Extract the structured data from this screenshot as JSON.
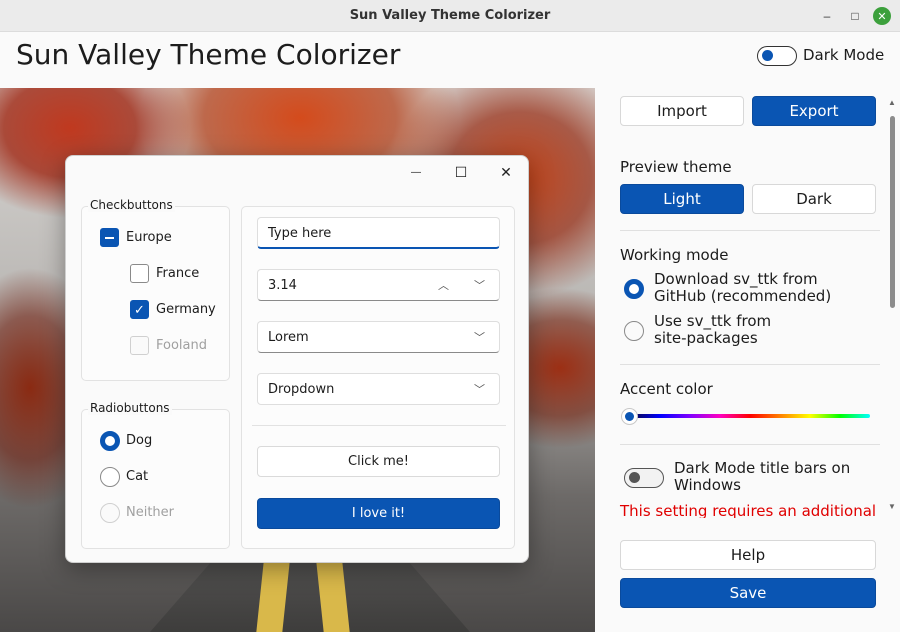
{
  "window": {
    "title": "Sun Valley Theme Colorizer",
    "controls": {
      "minimize": "–",
      "maximize": "□",
      "close": "✕"
    }
  },
  "header": {
    "app_title": "Sun Valley Theme Colorizer",
    "dark_mode_label": "Dark Mode",
    "dark_mode_on": false
  },
  "demo": {
    "controls": {
      "minimize": "—",
      "maximize": "☐",
      "close": "✕"
    },
    "checkbuttons": {
      "group_label": "Checkbuttons",
      "items": [
        {
          "label": "Europe",
          "state": "indeterminate"
        },
        {
          "label": "France",
          "state": "unchecked"
        },
        {
          "label": "Germany",
          "state": "checked"
        },
        {
          "label": "Fooland",
          "state": "disabled"
        }
      ]
    },
    "radiobuttons": {
      "group_label": "Radiobuttons",
      "items": [
        {
          "label": "Dog",
          "state": "selected"
        },
        {
          "label": "Cat",
          "state": "unselected"
        },
        {
          "label": "Neither",
          "state": "disabled"
        }
      ]
    },
    "entry_value": "Type here",
    "spinbox_value": "3.14",
    "combo_value": "Lorem",
    "dropdown_value": "Dropdown",
    "button_label": "Click me!",
    "accent_button_label": "I love it!"
  },
  "panel": {
    "import_label": "Import",
    "export_label": "Export",
    "preview_theme_label": "Preview theme",
    "light_label": "Light",
    "dark_label": "Dark",
    "working_mode_label": "Working mode",
    "mode_options": [
      {
        "line1": "Download sv_ttk from",
        "line2": "GitHub (recommended)",
        "selected": true
      },
      {
        "line1": "Use sv_ttk from",
        "line2": "site-packages",
        "selected": false
      }
    ],
    "accent_color_label": "Accent color",
    "accent_color": "#0a55b3",
    "titlebar_label_line1": "Dark Mode title bars on",
    "titlebar_label_line2": "Windows",
    "warning_text": "This setting requires an additional",
    "help_label": "Help",
    "save_label": "Save"
  }
}
